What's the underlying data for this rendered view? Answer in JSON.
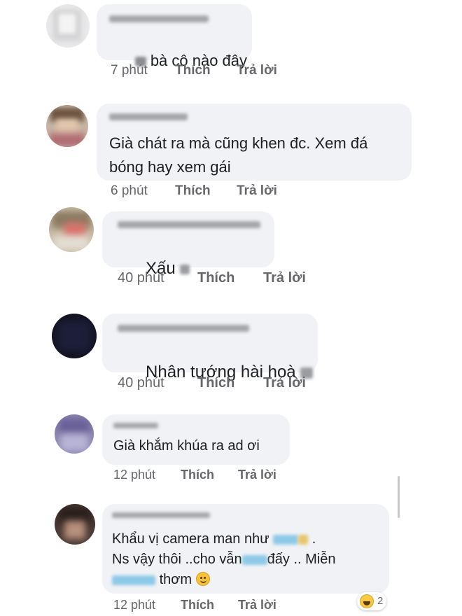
{
  "colors": {
    "bubble": "#f0f2f5",
    "meta_text": "#65676b",
    "body_text": "#1c1e21"
  },
  "comments": [
    {
      "name": "Nghiệp Nhuận",
      "text_lines": [
        "bà cô nào đây"
      ],
      "time": "7 phút",
      "like": "Thích",
      "reply": "Trả lời"
    },
    {
      "name": "Ngọc Lưu",
      "text_lines": [
        "Già chát ra mà cũng khen đc. Xem đá",
        "bóng hay xem gái"
      ],
      "time": "6 phút",
      "like": "Thích",
      "reply": "Trả lời"
    },
    {
      "name": "Thu Thảo Hữu Ngân",
      "text_lines": [
        "Xấu"
      ],
      "time": "40 phút",
      "like": "Thích",
      "reply": "Trả lời"
    },
    {
      "name": "Nguyễn Thị Thắng",
      "text_lines": [
        "Nhân tướng hài hoà"
      ],
      "time": "40 phút",
      "like": "Thích",
      "reply": "Trả lời"
    },
    {
      "name": "Mai Lý",
      "text_lines": [
        "Già khắm khúa ra ad ơi"
      ],
      "time": "12 phút",
      "like": "Thích",
      "reply": "Trả lời"
    },
    {
      "name": "Phạm Hữu Khải",
      "text_lines": [
        "Khẩu vị camera man như",
        "Ns vậy thôi ..cho vẫn",
        "đấy .. Miễn",
        "thơm"
      ],
      "time": "12 phút",
      "like": "Thích",
      "reply": "Trả lời",
      "reaction_count": "2"
    }
  ]
}
